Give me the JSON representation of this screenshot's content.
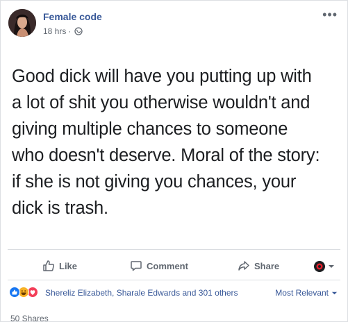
{
  "post": {
    "author": "Female code",
    "time": "18 hrs",
    "separator": "·",
    "more_glyph": "•••",
    "text_lines": [
      "Good dick will have you putting up with",
      "a lot of shit you otherwise wouldn't and",
      "giving multiple chances to someone",
      "who doesn't deserve. Moral of the story:",
      "if she is not giving you chances, your",
      "dick is trash."
    ]
  },
  "actions": {
    "like": "Like",
    "comment": "Comment",
    "share": "Share"
  },
  "reactions": {
    "names": "Shereliz Elizabeth, Sharale Edwards and 301 others",
    "sort": "Most Relevant",
    "shares": "50 Shares"
  },
  "colors": {
    "link": "#385898",
    "muted": "#606770",
    "like": "#1877f2",
    "haha": "#f7b125",
    "love": "#f33e58"
  },
  "icons": [
    "avatar",
    "globe-icon",
    "more-icon",
    "like-icon",
    "comment-icon",
    "share-icon",
    "audience-icon",
    "caret-down-icon"
  ]
}
